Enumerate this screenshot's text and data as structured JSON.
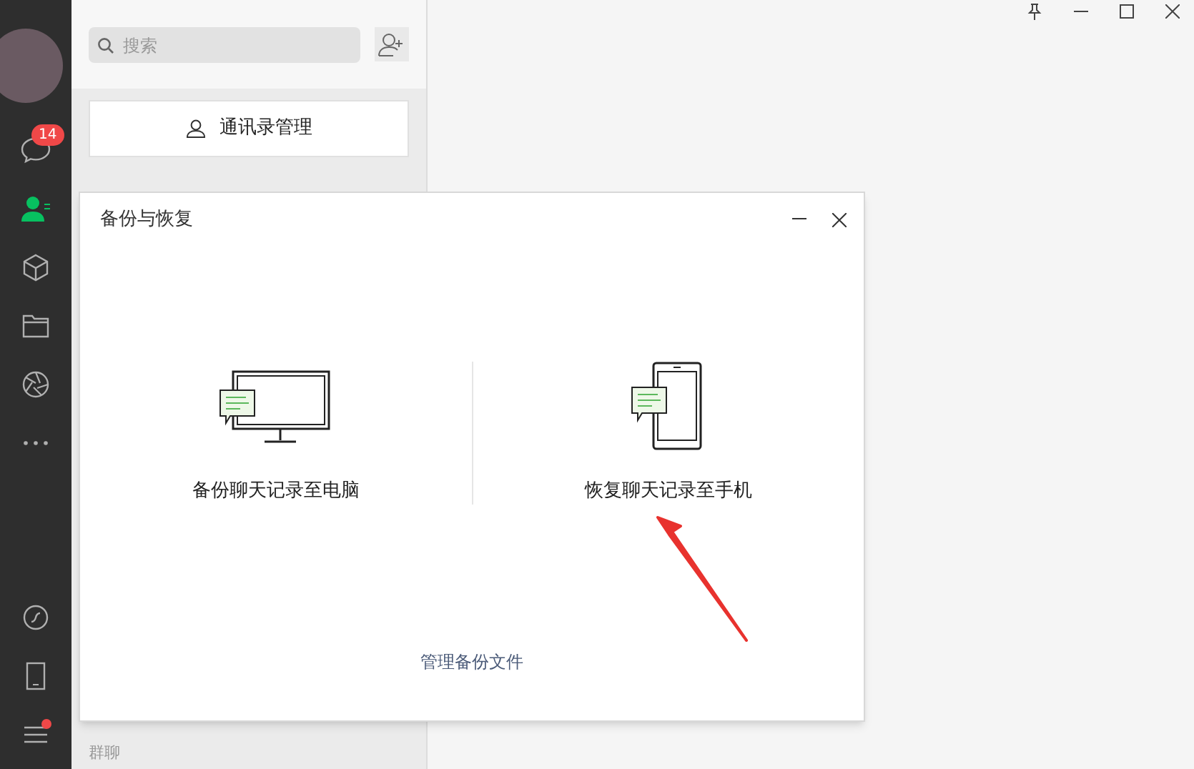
{
  "sidebar": {
    "items": [
      {
        "kind": "chat",
        "selected": false,
        "badge": "14"
      },
      {
        "kind": "contacts",
        "selected": true
      },
      {
        "kind": "cube",
        "selected": false
      },
      {
        "kind": "folder",
        "selected": false
      },
      {
        "kind": "aperture",
        "selected": false
      },
      {
        "kind": "more",
        "selected": false
      }
    ],
    "bottom_items": [
      {
        "kind": "miniprogram",
        "dot": false
      },
      {
        "kind": "phone",
        "dot": false
      },
      {
        "kind": "menu",
        "dot": true
      }
    ]
  },
  "contacts_panel": {
    "search": {
      "placeholder": "搜索"
    },
    "manage_button": "通讯录管理",
    "section_label": "群聊"
  },
  "dialog": {
    "title": "备份与恢复",
    "options": [
      {
        "kind": "computer",
        "label": "备份聊天记录至电脑"
      },
      {
        "kind": "phone",
        "label": "恢复聊天记录至手机"
      }
    ],
    "link": "管理备份文件"
  }
}
